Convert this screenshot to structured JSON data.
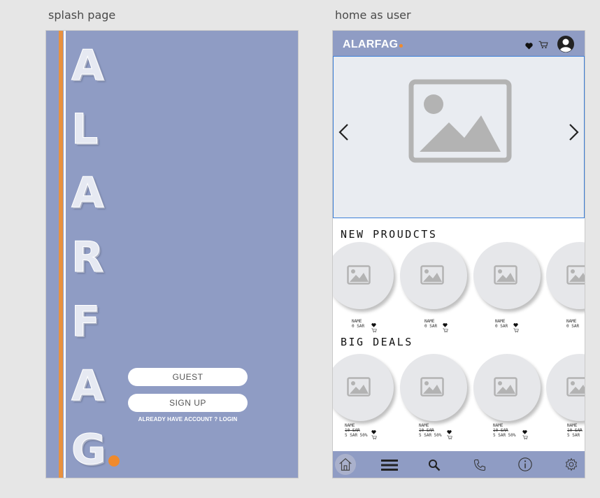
{
  "frames": {
    "splash_label": "splash page",
    "home_label": "home as user"
  },
  "splash": {
    "letters": [
      "A",
      "L",
      "A",
      "R",
      "F",
      "A",
      "G"
    ],
    "guest_label": "GUEST",
    "signup_label": "SIGN UP",
    "login_text": "ALREADY HAVE ACCOUNT ? LOGIN"
  },
  "home": {
    "brand": "ALARFAG",
    "icons": [
      "heart-icon",
      "cart-icon",
      "profile-icon"
    ],
    "new_products": {
      "title": "NEW PROUDCTS",
      "items": [
        {
          "name": "NAME",
          "price": "0 SAR"
        },
        {
          "name": "NAME",
          "price": "0 SAR"
        },
        {
          "name": "NAME",
          "price": "0 SAR"
        },
        {
          "name": "NAME",
          "price": "0 SAR"
        }
      ]
    },
    "big_deals": {
      "title": "BIG DEALS",
      "items": [
        {
          "name": "NAME",
          "old_price": "10 SAR",
          "new_price": "5 SAR 50%"
        },
        {
          "name": "NAME",
          "old_price": "10 SAR",
          "new_price": "5 SAR 50%"
        },
        {
          "name": "NAME",
          "old_price": "10 SAR",
          "new_price": "5 SAR 50%"
        },
        {
          "name": "NAME",
          "old_price": "10 SAR",
          "new_price": "5 SAR"
        }
      ]
    },
    "nav": [
      "home-icon",
      "menu-icon",
      "search-icon",
      "phone-icon",
      "info-icon",
      "settings-icon"
    ]
  },
  "colors": {
    "primary": "#8f9cc4",
    "accent": "#f08a2c",
    "carousel_border": "#3d7fd8"
  }
}
